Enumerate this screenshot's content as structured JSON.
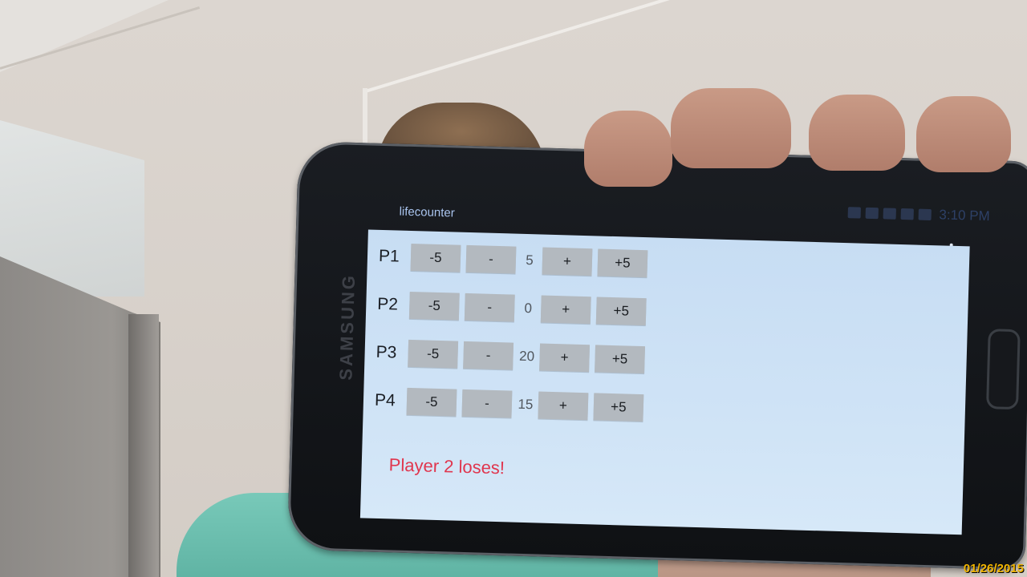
{
  "app": {
    "title": "lifecounter"
  },
  "status_bar": {
    "time": "3:10 PM"
  },
  "device": {
    "brand": "SAMSUNG"
  },
  "players": [
    {
      "label": "P1",
      "minus_five": "-5",
      "minus_one": "-",
      "life": "5",
      "plus_one": "+",
      "plus_five": "+5"
    },
    {
      "label": "P2",
      "minus_five": "-5",
      "minus_one": "-",
      "life": "0",
      "plus_one": "+",
      "plus_five": "+5"
    },
    {
      "label": "P3",
      "minus_five": "-5",
      "minus_one": "-",
      "life": "20",
      "plus_one": "+",
      "plus_five": "+5"
    },
    {
      "label": "P4",
      "minus_five": "-5",
      "minus_one": "-",
      "life": "15",
      "plus_one": "+",
      "plus_five": "+5"
    }
  ],
  "message": "Player 2 loses!",
  "camera": {
    "date_stamp": "01/26/2015"
  },
  "colors": {
    "loser_text": "#e0364e",
    "screen_bg": "#cfe3f6",
    "button_bg": "#b3b9bf",
    "timestamp": "#f0b400"
  },
  "icons": [
    "overflow-menu-icon",
    "notification-icon",
    "alarm-icon",
    "wifi-icon",
    "signal-icon",
    "battery-icon"
  ]
}
